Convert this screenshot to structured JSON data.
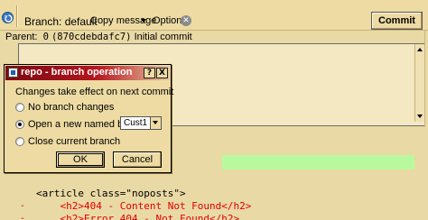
{
  "toolbar": {
    "branch_label": "Branch: default",
    "copy_message_label": "Copy message",
    "options_label": "Options",
    "commit_label": "Commit"
  },
  "parent": {
    "label": "Parent:",
    "rev": "0",
    "hash": "(870cdebdafc7)",
    "summary": "Initial commit"
  },
  "dialog": {
    "title": "repo - branch operation",
    "help_label": "?",
    "close_label": "X",
    "heading": "Changes take effect on next commit",
    "options": [
      {
        "label": "No branch changes",
        "selected": false
      },
      {
        "label": "Open a new named branch",
        "selected": true
      },
      {
        "label": "Close current branch",
        "selected": false
      }
    ],
    "branch_name_value": "Cust1",
    "ok_label": "OK",
    "cancel_label": "Cancel"
  },
  "diff": {
    "lines": [
      "<article class=\"noposts\">",
      "    <h2>404 - Content Not Found</h2>",
      "    <h2>Error 404 - Not Found</h2>"
    ],
    "minus": "-"
  },
  "colors": {
    "background": "#e9d9a5",
    "title_gradient_start": "#7b0812",
    "added_line_green": "#b9f99d",
    "removed_red": "#e00000"
  }
}
